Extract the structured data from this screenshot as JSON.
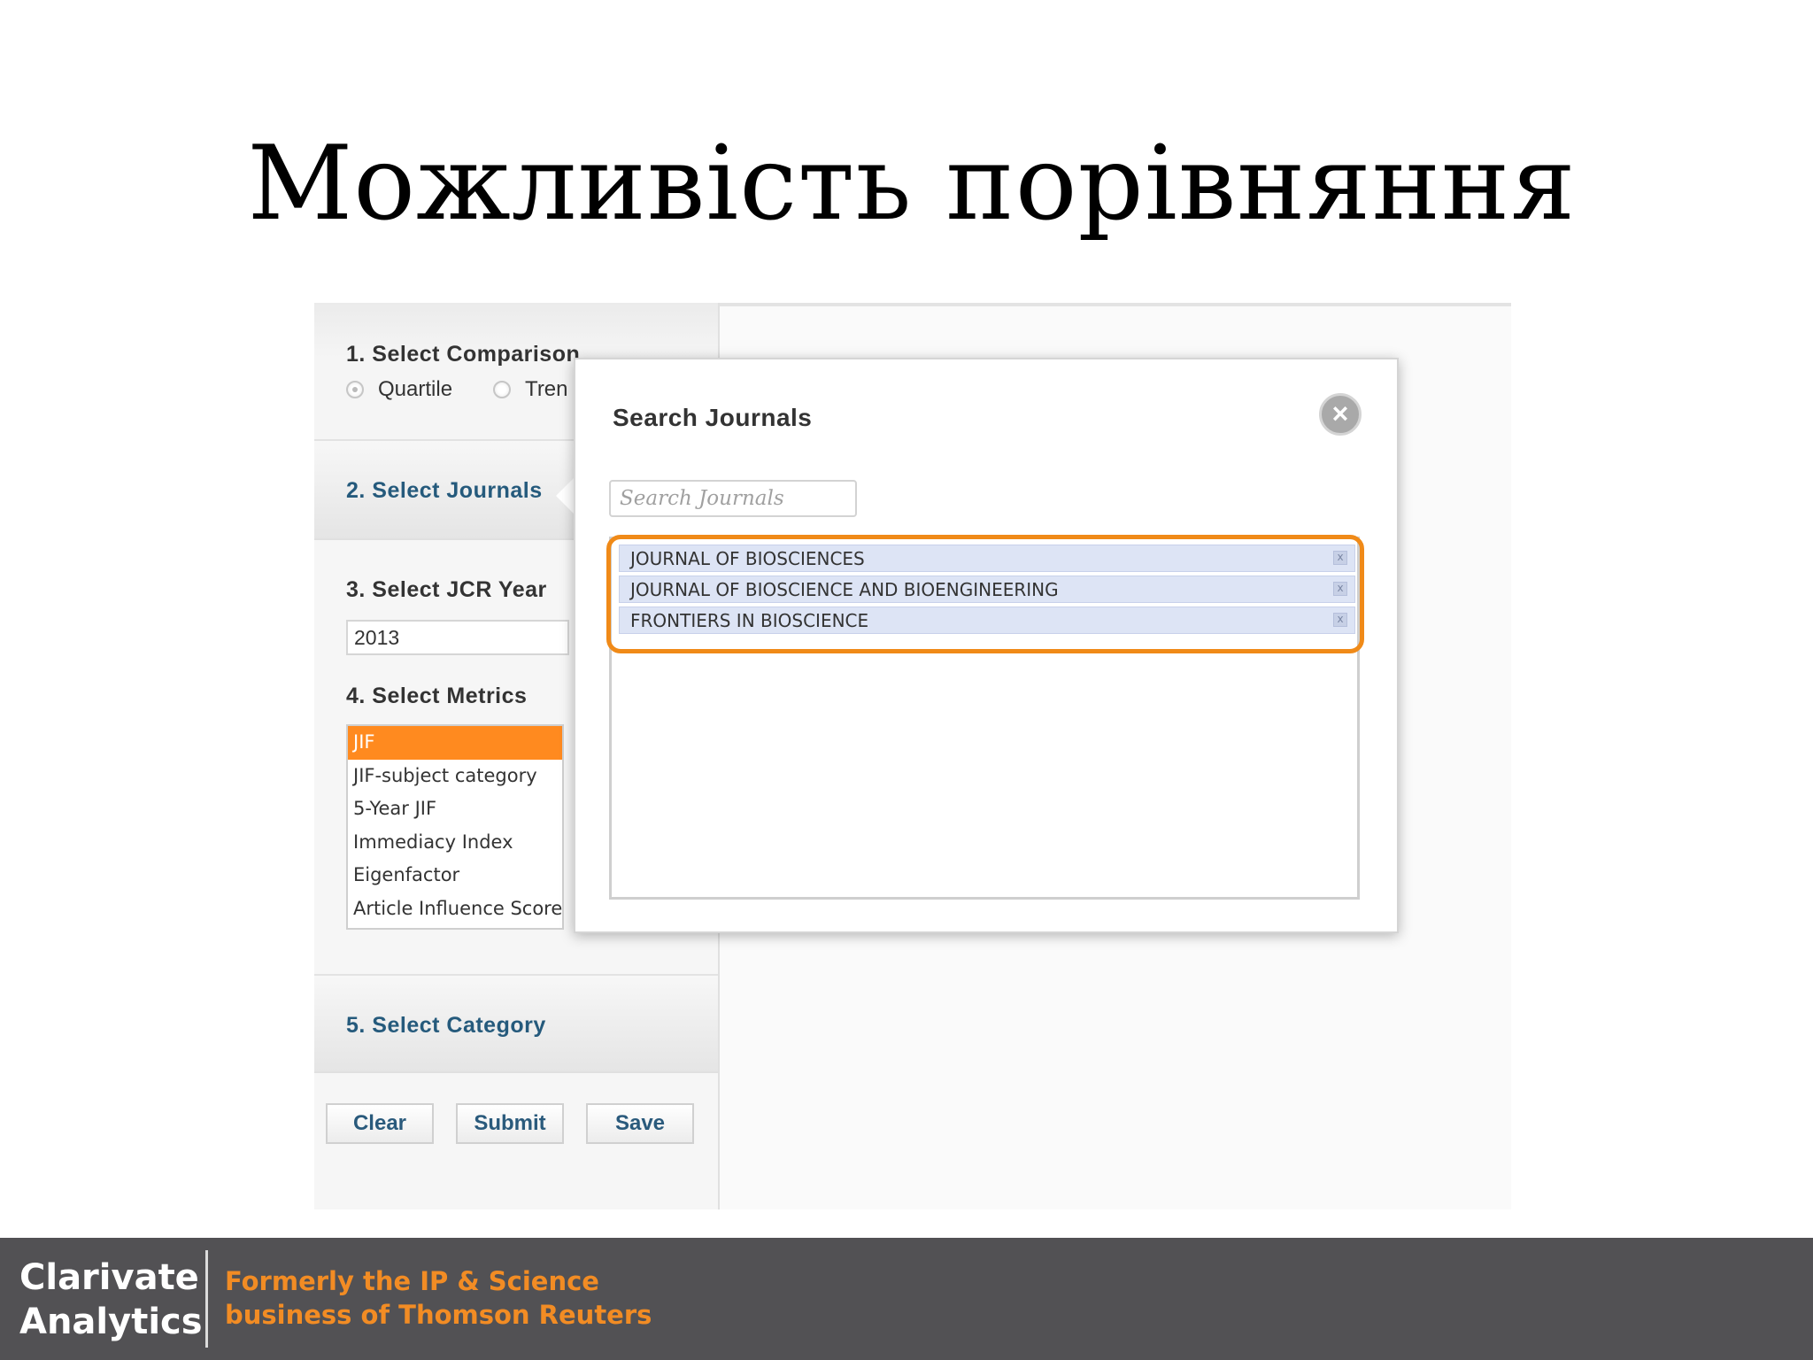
{
  "slide": {
    "title": "Можливість порівняння"
  },
  "sidebar": {
    "section1": {
      "heading": "1. Select Comparison",
      "options": [
        "Quartile",
        "Tren"
      ],
      "selected": "Quartile"
    },
    "section2": {
      "heading": "2. Select Journals"
    },
    "section3": {
      "heading": "3. Select JCR Year",
      "year_value": "2013"
    },
    "section4": {
      "heading": "4. Select Metrics",
      "items": [
        "JIF",
        "JIF-subject category",
        "5-Year JIF",
        "Immediacy Index",
        "Eigenfactor",
        "Article Influence Score"
      ],
      "selected": "JIF"
    },
    "section5": {
      "heading": "5. Select Category"
    },
    "buttons": {
      "clear": "Clear",
      "submit": "Submit",
      "save": "Save"
    }
  },
  "modal": {
    "title": "Search Journals",
    "close_icon": "close-icon",
    "search_placeholder": "Search Journals",
    "selected_journals": [
      "JOURNAL OF BIOSCIENCES",
      "JOURNAL OF BIOSCIENCE AND BIOENGINEERING",
      "FRONTIERS IN BIOSCIENCE"
    ],
    "remove_icon": "x"
  },
  "footer": {
    "brand_line1": "Clarivate",
    "brand_line2": "Analytics",
    "formerly_line1": "Formerly the IP & Science",
    "formerly_line2": "business of Thomson Reuters"
  },
  "colors": {
    "accent_orange": "#f08a18",
    "selected_metric": "#ff8a1f",
    "footer_bg": "#525154",
    "link_blue": "#255a7c"
  }
}
